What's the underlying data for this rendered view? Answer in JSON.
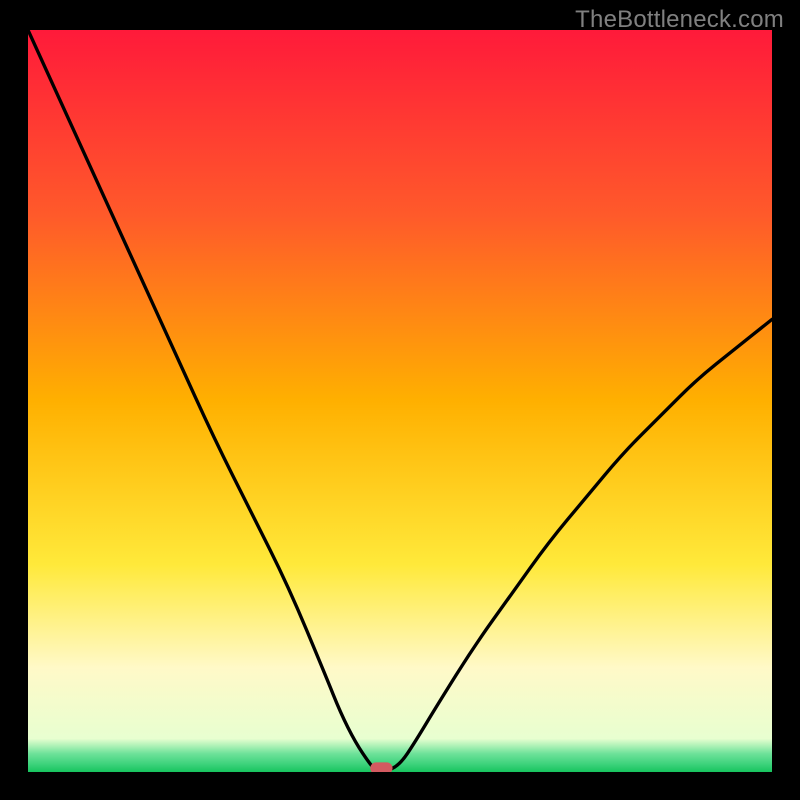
{
  "watermark": "TheBottleneck.com",
  "chart_data": {
    "type": "line",
    "title": "",
    "xlabel": "",
    "ylabel": "",
    "xlim": [
      0,
      100
    ],
    "ylim": [
      0,
      100
    ],
    "gradient_stops": [
      {
        "offset": 0.0,
        "color": "#ff1a3a"
      },
      {
        "offset": 0.25,
        "color": "#ff5a2a"
      },
      {
        "offset": 0.5,
        "color": "#ffb000"
      },
      {
        "offset": 0.72,
        "color": "#ffe93a"
      },
      {
        "offset": 0.86,
        "color": "#fff9c8"
      },
      {
        "offset": 0.955,
        "color": "#e8ffd0"
      },
      {
        "offset": 0.975,
        "color": "#6fe29a"
      },
      {
        "offset": 0.99,
        "color": "#3bd27a"
      },
      {
        "offset": 1.0,
        "color": "#17c45e"
      }
    ],
    "series": [
      {
        "name": "bottleneck-curve",
        "x": [
          0,
          5,
          10,
          15,
          20,
          25,
          30,
          35,
          40,
          42,
          44,
          46,
          47,
          48,
          50,
          52,
          55,
          60,
          65,
          70,
          75,
          80,
          85,
          90,
          95,
          100
        ],
        "y": [
          100,
          89,
          78,
          67,
          56,
          45,
          35,
          25,
          13,
          8,
          4,
          1,
          0,
          0,
          1,
          4,
          9,
          17,
          24,
          31,
          37,
          43,
          48,
          53,
          57,
          61
        ]
      }
    ],
    "marker": {
      "x": 47.5,
      "y": 0.5,
      "color": "#d35a60",
      "w": 3.0,
      "h": 1.6
    },
    "minimum_x": 47.5
  }
}
